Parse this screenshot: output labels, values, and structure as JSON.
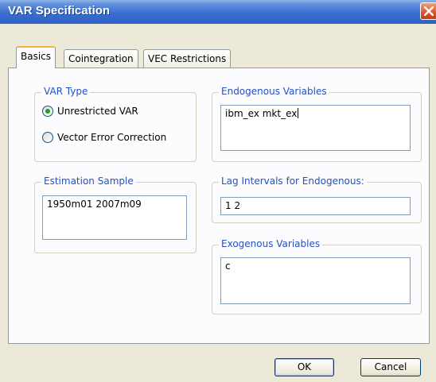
{
  "window": {
    "title": "VAR Specification"
  },
  "tabs": [
    {
      "label": "Basics",
      "active": true
    },
    {
      "label": "Cointegration",
      "active": false
    },
    {
      "label": "VEC Restrictions",
      "active": false
    }
  ],
  "var_type": {
    "legend": "VAR Type",
    "options": [
      {
        "label": "Unrestricted VAR",
        "selected": true
      },
      {
        "label": "Vector Error Correction",
        "selected": false
      }
    ]
  },
  "endogenous": {
    "legend": "Endogenous Variables",
    "value": "ibm_ex mkt_ex"
  },
  "estimation_sample": {
    "legend": "Estimation Sample",
    "value": "1950m01 2007m09"
  },
  "lag_intervals": {
    "legend": "Lag Intervals for Endogenous:",
    "value": "1 2"
  },
  "exogenous": {
    "legend": "Exogenous Variables",
    "value": "c"
  },
  "buttons": {
    "ok": "OK",
    "cancel": "Cancel"
  },
  "colors": {
    "titlebar": "#3a6fd0",
    "legend_text": "#2150c8",
    "dialog_bg": "#ece9d8",
    "radio_selected": "#21a121",
    "close_button": "#d9532c"
  },
  "icons": {
    "close": "close-icon"
  }
}
